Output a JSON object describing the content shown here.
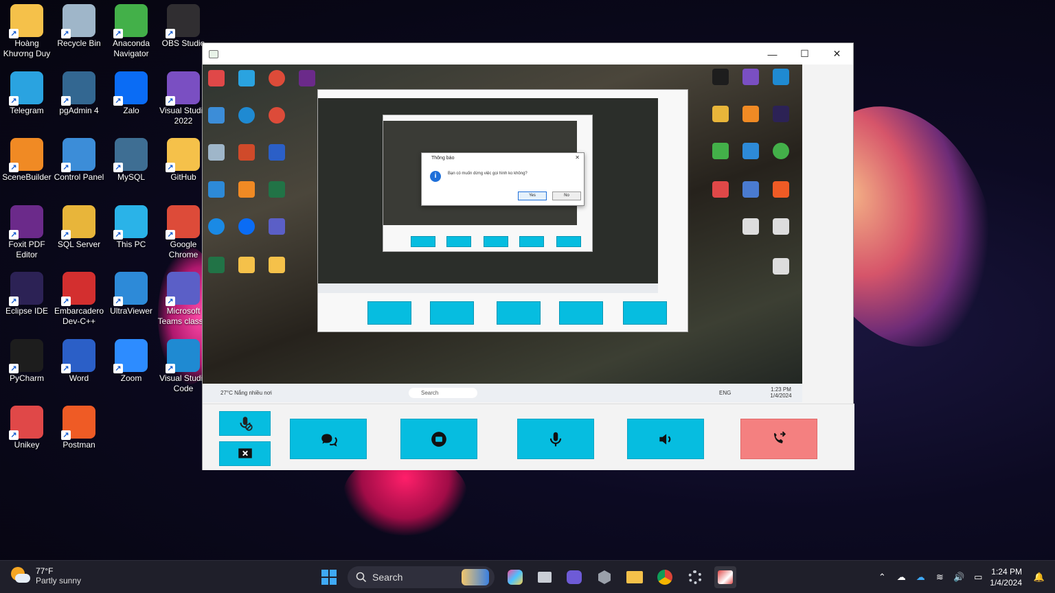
{
  "desktop": {
    "icons": [
      {
        "label": "Hoàng Khương Duy",
        "icon": "folder-user-icon",
        "color": "#f5c14a"
      },
      {
        "label": "Recycle Bin",
        "icon": "recycle-bin-icon",
        "color": "#9fb6c9"
      },
      {
        "label": "Anaconda Navigator",
        "icon": "anaconda-icon",
        "color": "#43b049"
      },
      {
        "label": "OBS Studio",
        "icon": "obs-icon",
        "color": "#302e31"
      },
      {
        "label": "Telegram",
        "icon": "telegram-icon",
        "color": "#2aa3e0"
      },
      {
        "label": "pgAdmin 4",
        "icon": "pgadmin-icon",
        "color": "#336791"
      },
      {
        "label": "Zalo",
        "icon": "zalo-icon",
        "color": "#0a6cf5"
      },
      {
        "label": "Visual Studio 2022",
        "icon": "visual-studio-icon",
        "color": "#7a4fc2"
      },
      {
        "label": "SceneBuilder",
        "icon": "scenebuilder-icon",
        "color": "#f08a24"
      },
      {
        "label": "Control Panel",
        "icon": "control-panel-icon",
        "color": "#3c8dd8"
      },
      {
        "label": "MySQL",
        "icon": "mysql-icon",
        "color": "#3e6e93"
      },
      {
        "label": "GitHub",
        "icon": "folder-icon",
        "color": "#f5c14a"
      },
      {
        "label": "Foxit PDF Editor",
        "icon": "foxit-icon",
        "color": "#6b2a8a"
      },
      {
        "label": "SQL Server",
        "icon": "sql-server-icon",
        "color": "#e8b53a"
      },
      {
        "label": "This PC",
        "icon": "monitor-icon",
        "color": "#2ab3e8"
      },
      {
        "label": "Google Chrome",
        "icon": "chrome-icon",
        "color": "#dd4b39"
      },
      {
        "label": "Eclipse IDE",
        "icon": "eclipse-icon",
        "color": "#2c2255"
      },
      {
        "label": "Embarcadero Dev-C++",
        "icon": "devcpp-icon",
        "color": "#d32f2f"
      },
      {
        "label": "UltraViewer",
        "icon": "ultraviewer-icon",
        "color": "#2d8ad8"
      },
      {
        "label": "Microsoft Teams classic",
        "icon": "teams-icon",
        "color": "#5b5fc7"
      },
      {
        "label": "PyCharm",
        "icon": "pycharm-icon",
        "color": "#1d1d1d"
      },
      {
        "label": "Word",
        "icon": "word-icon",
        "color": "#2b5fc7"
      },
      {
        "label": "Zoom",
        "icon": "zoom-icon",
        "color": "#2d8cff"
      },
      {
        "label": "Visual Studio Code",
        "icon": "vscode-icon",
        "color": "#1f8ad2"
      },
      {
        "label": "Unikey",
        "icon": "unikey-icon",
        "color": "#e04848"
      },
      {
        "label": "Postman",
        "icon": "postman-icon",
        "color": "#ef5b25"
      }
    ]
  },
  "window": {
    "title": "",
    "minimize": "—",
    "maximize": "☐",
    "close": "✕"
  },
  "remote": {
    "taskbar_weather": "27°C Nắng nhiều nơi",
    "search": "Search",
    "dialog": {
      "title": "Thông báo",
      "message": "Bạn có muốn dừng việc gọi hình ko không?",
      "yes": "Yes",
      "no": "No"
    },
    "clock": "1:23 PM 1/4/2024",
    "lang": "ENG"
  },
  "controls": {
    "left_top_icon": "mic-off-icon",
    "left_bottom_icon": "screen-share-stop-icon",
    "buttons": [
      {
        "name": "chat-button",
        "icon": "chat-icon"
      },
      {
        "name": "stop-button",
        "icon": "stop-icon"
      },
      {
        "name": "microphone-button",
        "icon": "microphone-icon"
      },
      {
        "name": "speaker-button",
        "icon": "speaker-icon"
      },
      {
        "name": "end-call-button",
        "icon": "end-call-icon",
        "color": "#f48080"
      }
    ],
    "accent": "#06bde0"
  },
  "taskbar": {
    "weather_temp": "77°F",
    "weather_desc": "Partly sunny",
    "search": "Search",
    "time": "1:24 PM",
    "date": "1/4/2024"
  }
}
